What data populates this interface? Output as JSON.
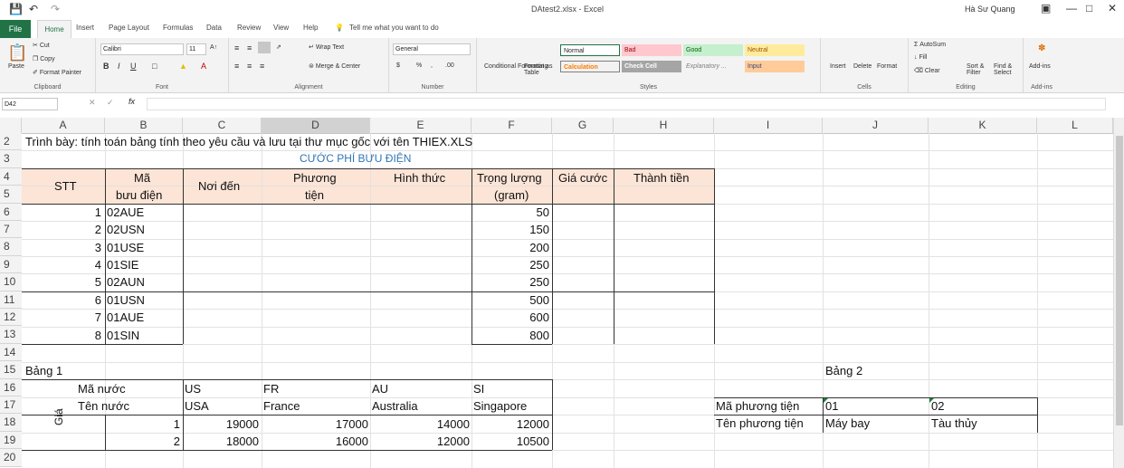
{
  "titlebar": {
    "autosave_icon": "save-icon",
    "title": "DAtest2.xlsx - Excel",
    "user": "Hà Sư Quang"
  },
  "tabs": [
    "File",
    "Home",
    "Insert",
    "Page Layout",
    "Formulas",
    "Data",
    "Review",
    "View",
    "Help"
  ],
  "tellme": "Tell me what you want to do",
  "ribbon": {
    "clipboard": {
      "label": "Clipboard",
      "paste": "Paste",
      "cut": "Cut",
      "copy": "Copy",
      "format_painter": "Format Painter"
    },
    "font": {
      "label": "Font",
      "name": "Calibri",
      "size": "11"
    },
    "alignment": {
      "label": "Alignment",
      "wrap": "Wrap Text",
      "merge": "Merge & Center"
    },
    "number": {
      "label": "Number",
      "format": "General"
    },
    "styles": {
      "label": "Styles",
      "cond": "Conditional Formatting",
      "fmt_table": "Format as Table",
      "normal": "Normal",
      "bad": "Bad",
      "good": "Good",
      "neutral": "Neutral",
      "calculation": "Calculation",
      "check_cell": "Check Cell",
      "explanatory": "Explanatory ...",
      "input": "Input"
    },
    "cells": {
      "label": "Cells",
      "insert": "Insert",
      "delete": "Delete",
      "format": "Format"
    },
    "editing": {
      "label": "Editing",
      "autosum": "AutoSum",
      "fill": "Fill",
      "clear": "Clear",
      "sort": "Sort & Filter",
      "find": "Find & Select"
    },
    "addins": {
      "label": "Add-ins",
      "addins": "Add-ins"
    }
  },
  "formula_bar": {
    "name_box": "D42",
    "fx": "fx",
    "value": ""
  },
  "columns": [
    "A",
    "B",
    "C",
    "D",
    "E",
    "F",
    "G",
    "H",
    "I",
    "J",
    "K",
    "L"
  ],
  "rows": [
    "2",
    "3",
    "4",
    "5",
    "6",
    "7",
    "8",
    "9",
    "10",
    "11",
    "12",
    "13",
    "14",
    "15",
    "16",
    "17",
    "18",
    "19",
    "20"
  ],
  "sheet": {
    "r2": "Trình bày: tính toán bảng tính theo yêu cầu và lưu tại thư mục gốc với tên THIEX.XLS",
    "r3": "CƯỚC PHÍ BƯU ĐIỆN",
    "headers": {
      "stt": "STT",
      "ma1": "Mã",
      "ma2": "bưu điện",
      "noiden": "Nơi đến",
      "pt1": "Phương",
      "pt2": "tiện",
      "hinhthuc": "Hình thức",
      "tl1": "Trọng lượng",
      "tl2": "(gram)",
      "giacuoc": "Giá cước",
      "thanhtien": "Thành tiền"
    },
    "data": [
      {
        "stt": "1",
        "ma": "02AUE",
        "tl": "50"
      },
      {
        "stt": "2",
        "ma": "02USN",
        "tl": "150"
      },
      {
        "stt": "3",
        "ma": "01USE",
        "tl": "200"
      },
      {
        "stt": "4",
        "ma": "01SIE",
        "tl": "250"
      },
      {
        "stt": "5",
        "ma": "02AUN",
        "tl": "250"
      },
      {
        "stt": "6",
        "ma": "01USN",
        "tl": "500"
      },
      {
        "stt": "7",
        "ma": "01AUE",
        "tl": "600"
      },
      {
        "stt": "8",
        "ma": "01SIN",
        "tl": "800"
      }
    ],
    "bang1": {
      "title": "Bảng 1",
      "ma_nuoc": "Mã nước",
      "ten_nuoc": "Tên nước",
      "gia": "Giá",
      "codes": [
        "US",
        "FR",
        "AU",
        "SI"
      ],
      "names": [
        "USA",
        "France",
        "Australia",
        "Singapore"
      ],
      "price_rows": [
        {
          "k": "1",
          "v": [
            "19000",
            "17000",
            "14000",
            "12000"
          ]
        },
        {
          "k": "2",
          "v": [
            "18000",
            "16000",
            "12000",
            "10500"
          ]
        }
      ]
    },
    "bang2": {
      "title": "Bảng 2",
      "ma_pt": "Mã phương tiện",
      "ten_pt": "Tên phương tiện",
      "codes": [
        "01",
        "02"
      ],
      "names": [
        "Máy bay",
        "Tàu thủy"
      ]
    }
  }
}
